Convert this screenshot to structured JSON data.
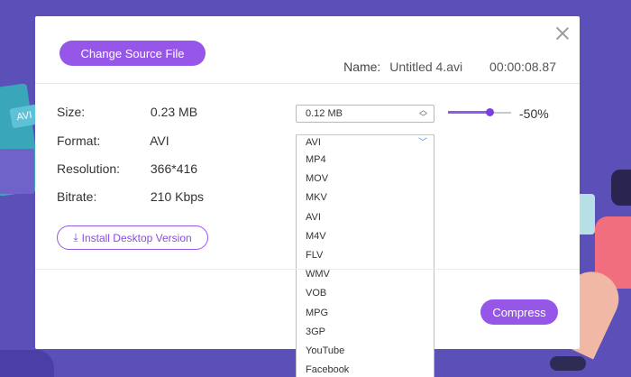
{
  "background": {
    "tag_text": "AVI",
    "color": "#5b4fb8"
  },
  "dialog": {
    "change_source_label": "Change Source File",
    "name_label": "Name:",
    "file_name": "Untitled 4.avi",
    "duration": "00:00:08.87",
    "info": {
      "size_label": "Size:",
      "size_value": "0.23 MB",
      "format_label": "Format:",
      "format_value": "AVI",
      "resolution_label": "Resolution:",
      "resolution_value": "366*416",
      "bitrate_label": "Bitrate:",
      "bitrate_value": "210 Kbps"
    },
    "install_label": "Install Desktop Version",
    "target_size": "0.12  MB",
    "compression_percent": "-50%",
    "compression_level": 0.66,
    "format_selected": "AVI",
    "format_options": [
      "MP4",
      "MOV",
      "MKV",
      "AVI",
      "M4V",
      "FLV",
      "WMV",
      "VOB",
      "MPG",
      "3GP",
      "YouTube",
      "Facebook"
    ],
    "compress_label": "Compress"
  },
  "colors": {
    "accent": "#9657e8",
    "link_blue": "#3a8ee6"
  }
}
